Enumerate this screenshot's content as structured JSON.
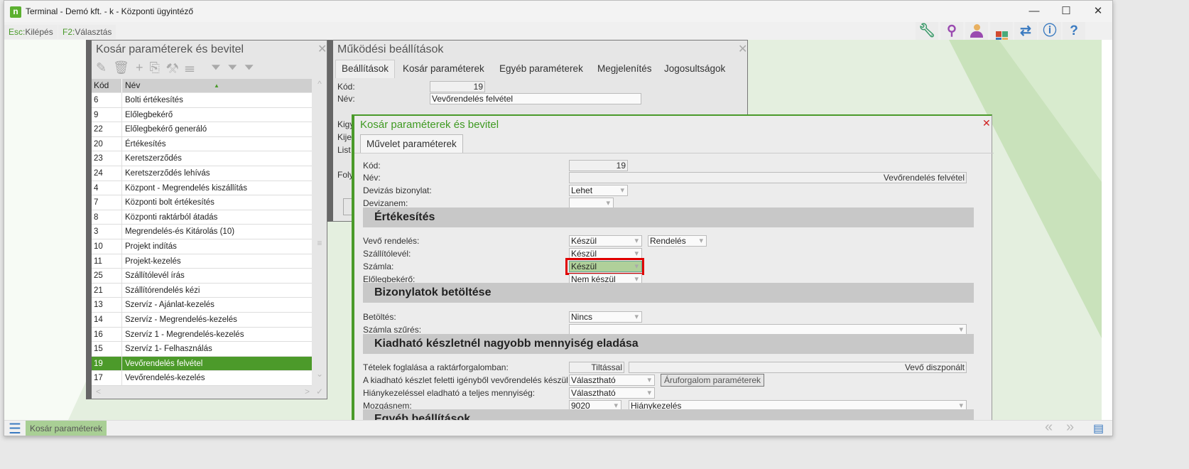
{
  "window": {
    "title": "Terminal - Demó kft. - k - Központi ügyintéző",
    "logo": "n"
  },
  "toolbar": {
    "keys": [
      {
        "key": "Esc:",
        "label": "Kilépés"
      },
      {
        "key": "F2:",
        "label": "Választás"
      }
    ],
    "icons": [
      "wrench-icon",
      "search-icon",
      "user-icon",
      "apps-icon",
      "swap-icon",
      "info-icon",
      "help-icon"
    ]
  },
  "list_panel": {
    "title": "Kosár paraméterek és bevitel",
    "col_code": "Kód",
    "col_name": "Név",
    "rows": [
      [
        "6",
        "Bolti értékesítés"
      ],
      [
        "9",
        "Előlegbekérő"
      ],
      [
        "22",
        "Előlegbekérő generáló"
      ],
      [
        "20",
        "Értékesítés"
      ],
      [
        "23",
        "Keretszerződés"
      ],
      [
        "24",
        "Keretszerződés lehívás"
      ],
      [
        "4",
        "Központ - Megrendelés kiszállítás"
      ],
      [
        "7",
        "Központi bolt értékesítés"
      ],
      [
        "8",
        "Központi raktárból átadás"
      ],
      [
        "3",
        "Megrendelés-és Kitárolás (10)"
      ],
      [
        "10",
        "Projekt indítás"
      ],
      [
        "11",
        "Projekt-kezelés"
      ],
      [
        "25",
        "Szállítólevél írás"
      ],
      [
        "21",
        "Szállítórendelés kézi"
      ],
      [
        "13",
        "Szervíz - Ajánlat-kezelés"
      ],
      [
        "14",
        "Szervíz - Megrendelés-kezelés"
      ],
      [
        "16",
        "Szervíz 1 - Megrendelés-kezelés"
      ],
      [
        "15",
        "Szervíz 1- Felhasználás"
      ],
      [
        "19",
        "Vevőrendelés felvétel"
      ],
      [
        "17",
        "Vevőrendelés-kezelés"
      ]
    ],
    "selected_index": 18
  },
  "settings_panel": {
    "title": "Működési beállítások",
    "tabs": [
      "Beállítások",
      "Kosár paraméterek",
      "Egyéb paraméterek",
      "Megjelenítés",
      "Jogosultságok"
    ],
    "code_label": "Kód:",
    "code": "19",
    "name_label": "Név:",
    "name": "Vevőrendelés felvétel",
    "partial_labels": [
      "Kigy",
      "Kije",
      "List",
      "Foly"
    ]
  },
  "dialog": {
    "title": "Kosár paraméterek és bevitel",
    "tab": "Művelet paraméterek",
    "code_label": "Kód:",
    "code": "19",
    "name_label": "Név:",
    "name": "Vevőrendelés felvétel",
    "currency_doc_label": "Devizás bizonylat:",
    "currency_doc": "Lehet",
    "currency_label": "Devizanem:",
    "currency": "",
    "sec_sales": "Értékesítés",
    "order_label": "Vevő rendelés:",
    "order": "Készül",
    "order_type": "Rendelés",
    "delivery_label": "Szállítólevél:",
    "delivery": "Készül",
    "invoice_label": "Számla:",
    "invoice": "Készül",
    "proforma_label": "Előlegbekérő:",
    "proforma": "Nem készül",
    "sec_load": "Bizonylatok betöltése",
    "load_label": "Betöltés:",
    "load": "Nincs",
    "invoice_filter_label": "Számla szűrés:",
    "invoice_filter": "",
    "sec_stock": "Kiadható készletnél nagyobb mennyiség eladása",
    "reserve_label": "Tételek foglalása a raktárforgalomban:",
    "reserve": "Tiltással",
    "reserve2": "Vevő diszponált",
    "over_label": "A kiadható készlet feletti igényből vevőrendelés készül:",
    "over": "Választható",
    "goods_button": "Áruforgalom paraméterek",
    "shortage_label": "Hiánykezeléssel eladható a teljes mennyiség:",
    "shortage": "Választható",
    "movement_label": "Mozgásnem:",
    "movement_code": "9020",
    "movement_name": "Hiánykezelés",
    "sec_other": "Egyéb beállítások"
  },
  "bottom": {
    "task": "Kosár paraméterek"
  }
}
